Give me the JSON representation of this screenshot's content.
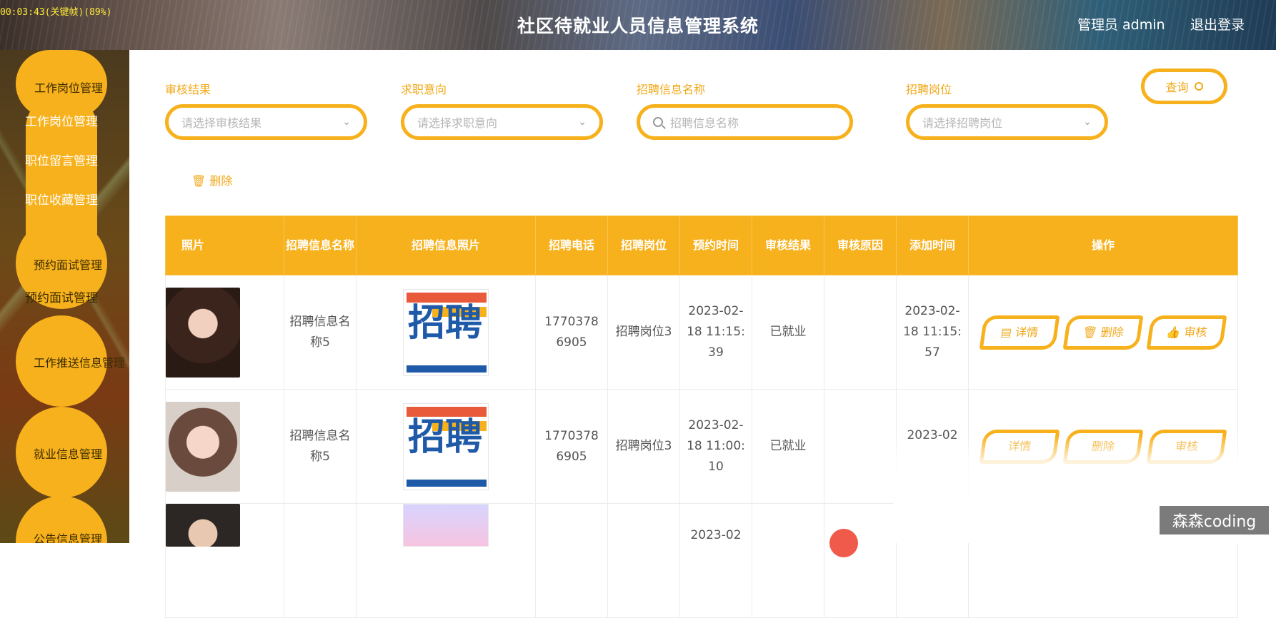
{
  "header": {
    "clock": "00:03:43(关键帧)(89%)",
    "title": "社区待就业人员信息管理系统",
    "admin": "管理员 admin",
    "logout": "退出登录"
  },
  "sidebar": {
    "groups": [
      {
        "label": "工作岗位管理",
        "items": [
          "工作岗位管理",
          "职位留言管理",
          "职位收藏管理"
        ]
      },
      {
        "label": "预约面试管理",
        "items": [
          "预约面试管理"
        ]
      },
      {
        "label": "工作推送信息管理",
        "items": []
      },
      {
        "label": "就业信息管理",
        "items": []
      },
      {
        "label": "公告信息管理",
        "items": []
      }
    ]
  },
  "search": {
    "audit_label": "审核结果",
    "audit_placeholder": "请选择审核结果",
    "intent_label": "求职意向",
    "intent_placeholder": "请选择求职意向",
    "name_label": "招聘信息名称",
    "name_placeholder": "招聘信息名称",
    "post_label": "招聘岗位",
    "post_placeholder": "请选择招聘岗位",
    "query_button": "查询",
    "delete_button": "删除"
  },
  "table": {
    "headers": [
      "照片",
      "招聘信息名称",
      "招聘信息照片",
      "招聘电话",
      "招聘岗位",
      "预约时间",
      "审核结果",
      "审核原因",
      "添加时间",
      "操作"
    ],
    "rows": [
      {
        "name": "招聘信息名称5",
        "phone": "17703786905",
        "post": "招聘岗位3",
        "appoint": "2023-02-18 11:15:39",
        "result": "已就业",
        "reason": "",
        "added": "2023-02-18 11:15:57",
        "photo_color": "#5a3a2c"
      },
      {
        "name": "招聘信息名称5",
        "phone": "17703786905",
        "post": "招聘岗位3",
        "appoint": "2023-02-18 11:00:10",
        "result": "已就业",
        "reason": "",
        "added": "2023-02",
        "photo_color": "#c8a090"
      },
      {
        "name": "",
        "phone": "",
        "post": "",
        "appoint": "2023-02",
        "result": "",
        "reason": "",
        "added": "",
        "photo_color": "#3d3430"
      }
    ],
    "actions": [
      "详情",
      "删除",
      "审核"
    ],
    "poster_char": "招聘"
  },
  "watermark": "森森coding"
}
